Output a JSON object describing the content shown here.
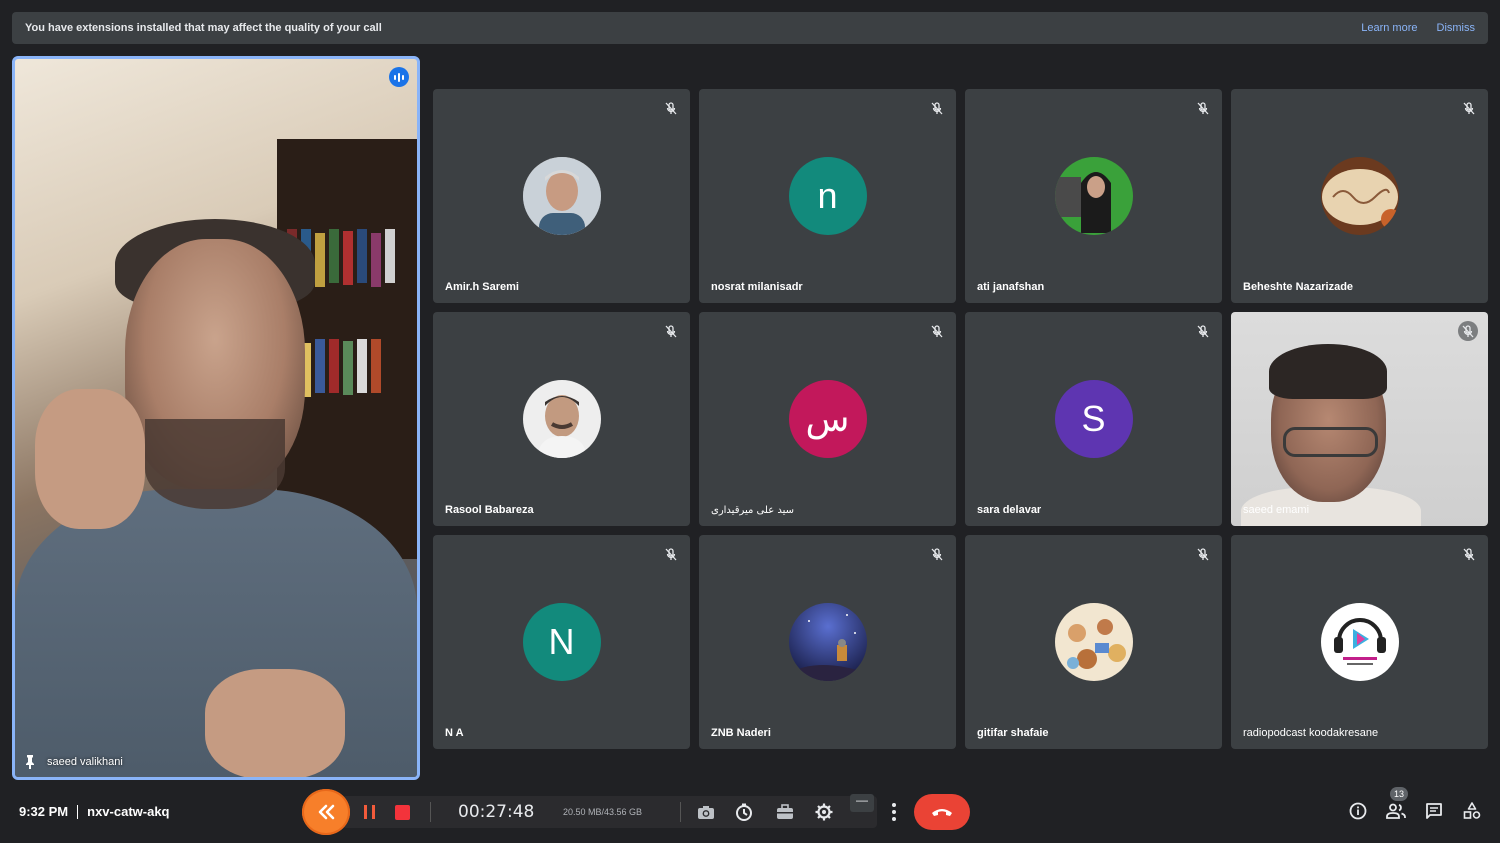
{
  "banner": {
    "message": "You have extensions installed that may affect the quality of your call",
    "learn_more": "Learn more",
    "dismiss": "Dismiss"
  },
  "pinned": {
    "name": "saeed valikhani",
    "icon": "pin-icon",
    "speaking_icon": "audio-level-icon"
  },
  "participants": [
    {
      "name": "Amir.h Saremi",
      "avatar": "photo",
      "avatar_color": "#9aa3ab",
      "muted": true
    },
    {
      "name": "nosrat milanisadr",
      "avatar": "n",
      "avatar_color": "#128a7c",
      "muted": true
    },
    {
      "name": "ati janafshan",
      "avatar": "photo",
      "avatar_color": "#3aa13a",
      "muted": true
    },
    {
      "name": "Beheshte Nazarizade",
      "avatar": "photo",
      "avatar_color": "#c8a57a",
      "muted": true
    },
    {
      "name": "Rasool Babareza",
      "avatar": "photo",
      "avatar_color": "#e9e9e9",
      "muted": true
    },
    {
      "name": "سید علی میرقیداری",
      "avatar": "س",
      "avatar_color": "#c2185b",
      "muted": true
    },
    {
      "name": "sara delavar",
      "avatar": "S",
      "avatar_color": "#5e35b1",
      "muted": true
    },
    {
      "name": "saeed emami",
      "avatar": "video",
      "avatar_color": "#d5d5d5",
      "muted": true
    },
    {
      "name": "N A",
      "avatar": "N",
      "avatar_color": "#128a7c",
      "muted": true
    },
    {
      "name": "ZNB Naderi",
      "avatar": "photo",
      "avatar_color": "#2a3b7a",
      "muted": true
    },
    {
      "name": "gitifar shafaie",
      "avatar": "photo",
      "avatar_color": "#d9a56a",
      "muted": true
    },
    {
      "name": "radiopodcast koodakresane",
      "avatar": "photo",
      "avatar_color": "#ffffff",
      "muted": true
    }
  ],
  "footer": {
    "time": "9:32 PM",
    "meeting_code": "nxv-catw-akq",
    "participants_count": "13"
  },
  "recorder": {
    "elapsed": "00:27:48",
    "size": "20.50 MB/43.56 GB",
    "minimize": "—",
    "accent": "#f77f2a"
  },
  "colors": {
    "background": "#202124",
    "tile": "#3c4043",
    "end_call": "#ea4335",
    "link": "#8ab4f8"
  }
}
